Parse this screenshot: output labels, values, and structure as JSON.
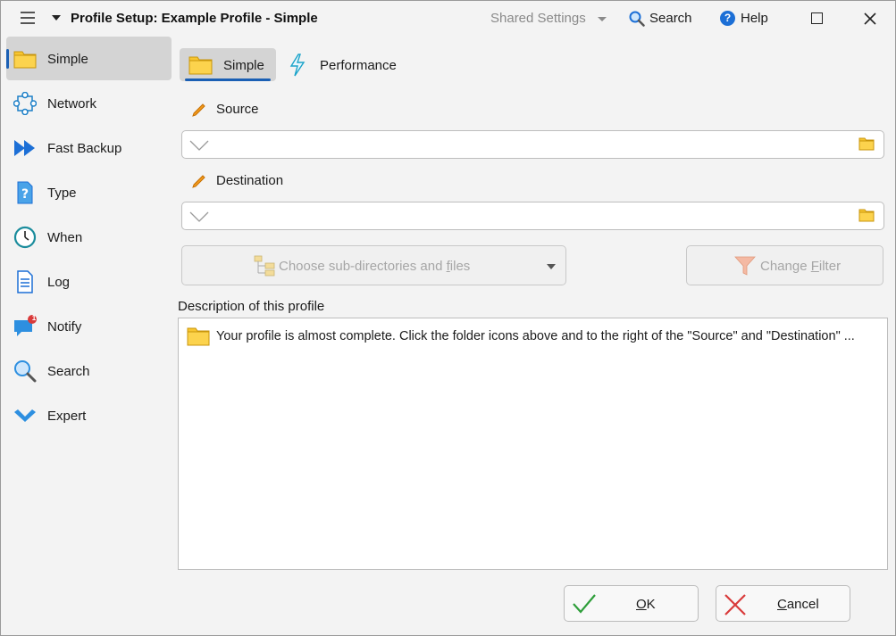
{
  "titlebar": {
    "title": "Profile Setup: Example Profile - Simple",
    "shared_settings": "Shared Settings",
    "search": "Search",
    "help": "Help"
  },
  "sidebar": {
    "items": [
      {
        "label": "Simple",
        "icon": "folder-icon",
        "active": true
      },
      {
        "label": "Network",
        "icon": "network-icon"
      },
      {
        "label": "Fast Backup",
        "icon": "fast-forward-icon"
      },
      {
        "label": "Type",
        "icon": "document-question-icon"
      },
      {
        "label": "When",
        "icon": "clock-icon"
      },
      {
        "label": "Log",
        "icon": "log-document-icon"
      },
      {
        "label": "Notify",
        "icon": "chat-notification-icon",
        "badge": "1"
      },
      {
        "label": "Search",
        "icon": "magnifier-icon"
      },
      {
        "label": "Expert",
        "icon": "checkmark-chevron-icon"
      }
    ]
  },
  "tabs": [
    {
      "label": "Simple",
      "active": true
    },
    {
      "label": "Performance"
    }
  ],
  "source": {
    "label": "Source",
    "value": ""
  },
  "destination": {
    "label": "Destination",
    "value": ""
  },
  "subdirs_button": {
    "label_pre": "Choose sub-directories and ",
    "label_key": "f",
    "label_post": "iles"
  },
  "filter_button": {
    "label_pre": "Change ",
    "label_key": "F",
    "label_post": "ilter"
  },
  "description": {
    "label": "Description of this profile",
    "text": "Your profile is almost complete. Click the folder icons above and to the right of the \"Source\" and \"Destination\" ..."
  },
  "ok_button": {
    "label_key": "O",
    "label_post": "K"
  },
  "cancel_button": {
    "label_key": "C",
    "label_post": "ancel"
  },
  "colors": {
    "accent": "#1a5fb4",
    "folder": "#f7c530",
    "ok_check": "#2e9e3a",
    "cancel_x": "#d93a3a"
  }
}
